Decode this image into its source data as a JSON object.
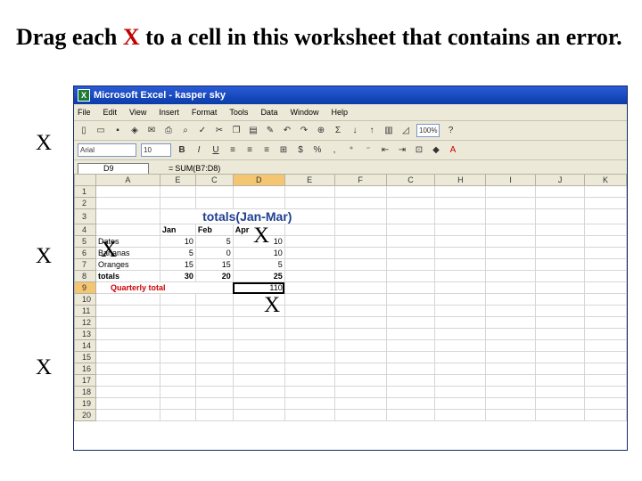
{
  "instruction": {
    "before": "Drag each ",
    "highlight": "X",
    "after": " to a cell in this worksheet that contains an error."
  },
  "drag_marks": [
    "X",
    "X",
    "X",
    "X",
    "X",
    "X"
  ],
  "window": {
    "title": "Microsoft Excel - kasper sky"
  },
  "menu": [
    "File",
    "Edit",
    "View",
    "Insert",
    "Format",
    "Tools",
    "Data",
    "Window",
    "Help"
  ],
  "toolbar": {
    "zoom": "100%",
    "font": "Arial",
    "size": "10"
  },
  "formula_bar": {
    "name_box": "D9",
    "fx": "=",
    "formula": "SUM(B7:D8)"
  },
  "columns": [
    "A",
    "E",
    "C",
    "D",
    "E",
    "F",
    "C",
    "H",
    "I",
    "J",
    "K"
  ],
  "row_numbers": [
    "1",
    "2",
    "3",
    "4",
    "5",
    "6",
    "7",
    "8",
    "9",
    "10",
    "11",
    "12",
    "13",
    "14",
    "15",
    "16",
    "17",
    "18",
    "19",
    "20"
  ],
  "sheet": {
    "heading": "totals(Jan-Mar)",
    "months": [
      "Jan",
      "Feb",
      "Apr"
    ],
    "rows": [
      {
        "label": "Dates",
        "jan": "10",
        "feb": "5",
        "mar": "10"
      },
      {
        "label": "Bananas",
        "jan": "5",
        "feb": "0",
        "mar": "10"
      },
      {
        "label": "Oranges",
        "jan": "15",
        "feb": "15",
        "mar": "5"
      },
      {
        "label": "totals",
        "jan": "30",
        "feb": "20",
        "mar": "25"
      }
    ],
    "quarterly_label": "Quarterly total",
    "quarterly_value": "110"
  },
  "colors": {
    "accent_red": "#c00000",
    "title_blue": "#1f3f8f",
    "excel_frame": "#1f3f8f"
  }
}
